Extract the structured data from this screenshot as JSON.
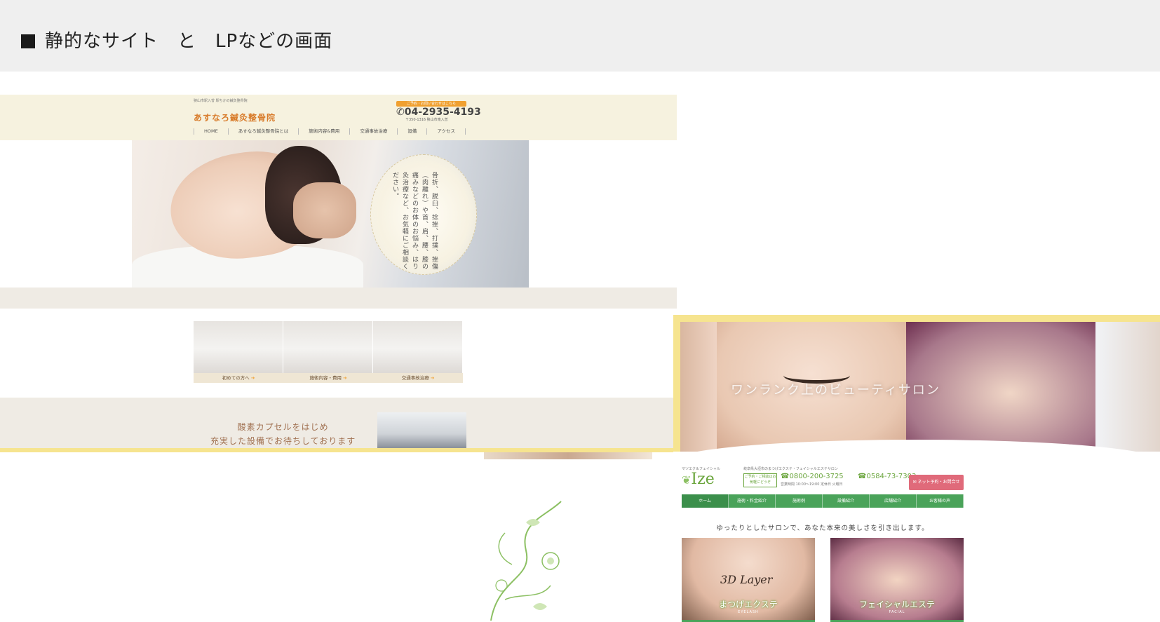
{
  "header": {
    "title": "静的なサイト　と　LPなどの画面"
  },
  "clinic_site": {
    "tagline": "狭山市駅入曽 駅ちかの鍼灸整骨院",
    "logo": "あすなろ鍼灸整骨院",
    "tel_badge": "ご予約・お問い合わせはこちら",
    "phone": "04-2935-4193",
    "address": "〒350-1316 狭山市南入曽",
    "nav": [
      "HOME",
      "あすなろ鍼灸整骨院とは",
      "施術内容&費用",
      "交通事故治療",
      "設備",
      "アクセス"
    ],
    "hero_copy": "骨折、脱臼、捻挫、打撲、挫傷（肉離れ）や首、肩、腰、膝の痛みなどのお体のお悩み、はり灸治療など、お気軽にご相談ください。",
    "cards": [
      {
        "label": "初めての方へ",
        "arrow": "➔"
      },
      {
        "label": "施術内容・費用",
        "arrow": "➔"
      },
      {
        "label": "交通事故治療",
        "arrow": "➔"
      }
    ],
    "lower_text_1": "酸素カプセルをはじめ",
    "lower_text_2": "充実した設備でお待ちしております"
  },
  "salon_site": {
    "slide_copy": "ワンランク上のビューティサロン",
    "logo_sub": "マツエク＆フェイシャル",
    "logo": "Ize",
    "info": "岐阜県大垣市のまつげエクステ・フェイシャルエステサロン",
    "notice": "ご予約・ご相談はお気軽にどうぞ",
    "tel_1": "0800-200-3725",
    "tel_2": "0584-73-7303",
    "hours": "営業時間 10:00〜19:00 定休日 火曜日",
    "book_button": "ネット予約・お問合せ",
    "nav": [
      "ホーム",
      "施術・料金紹介",
      "施術例",
      "設備紹介",
      "店舗紹介",
      "お客様の声"
    ],
    "lead": "ゆったりとしたサロンで、あなた本来の美しさを引き出します。",
    "tiles": [
      {
        "eng": "3D Layer",
        "title": "まつげエクステ",
        "sub": "EYELASH"
      },
      {
        "eng": "",
        "title": "フェイシャルエステ",
        "sub": "FACIAL"
      }
    ]
  }
}
